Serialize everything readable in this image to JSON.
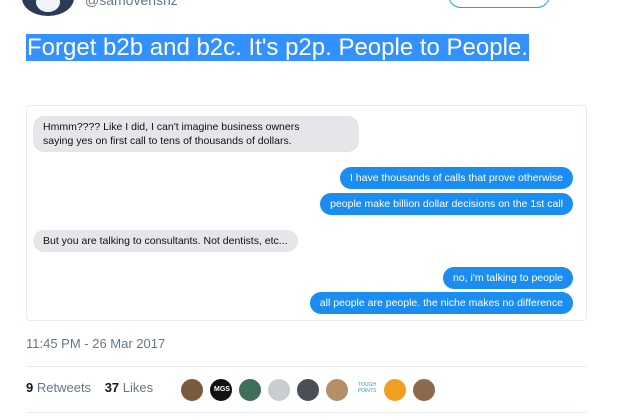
{
  "header": {
    "handle": "@samovensnz"
  },
  "tweet": {
    "text": "Forget b2b and b2c. It's p2p. People to People."
  },
  "conversation": [
    {
      "direction": "in",
      "text": "Hmmm???? Like I did, I can't imagine business owners\nsaying yes on first call to tens of thousands of dollars."
    },
    {
      "direction": "out",
      "text": "I have thousands of calls that prove otherwise"
    },
    {
      "direction": "out",
      "text": "people make billion dollar decisions on the 1st call"
    },
    {
      "direction": "in",
      "text": "But you are talking to consultants. Not dentists, etc..."
    },
    {
      "direction": "out",
      "text": "no, i'm talking to people"
    },
    {
      "direction": "out",
      "text": "all people are people.  the niche makes no difference"
    }
  ],
  "timestamp": "11:45 PM - 26 Mar 2017",
  "stats": {
    "retweets_count": "9",
    "retweets_label": "Retweets",
    "likes_count": "37",
    "likes_label": "Likes"
  },
  "likers": [
    {
      "name": "liker-1-avatar",
      "color": "#7a5a3c"
    },
    {
      "name": "liker-2-avatar",
      "color": "#111111",
      "text": "MGS"
    },
    {
      "name": "liker-3-avatar",
      "color": "#3f6e5a"
    },
    {
      "name": "liker-4-avatar",
      "color": "#c9cdd2"
    },
    {
      "name": "liker-5-avatar",
      "color": "#4a4f55"
    },
    {
      "name": "liker-6-avatar",
      "color": "#b58f6a"
    },
    {
      "name": "liker-7-avatar",
      "color": "#ffffff",
      "text": "TOUGH POINTS"
    },
    {
      "name": "liker-8-avatar",
      "color": "#f0a020"
    },
    {
      "name": "liker-9-avatar",
      "color": "#8a6a4a"
    }
  ]
}
